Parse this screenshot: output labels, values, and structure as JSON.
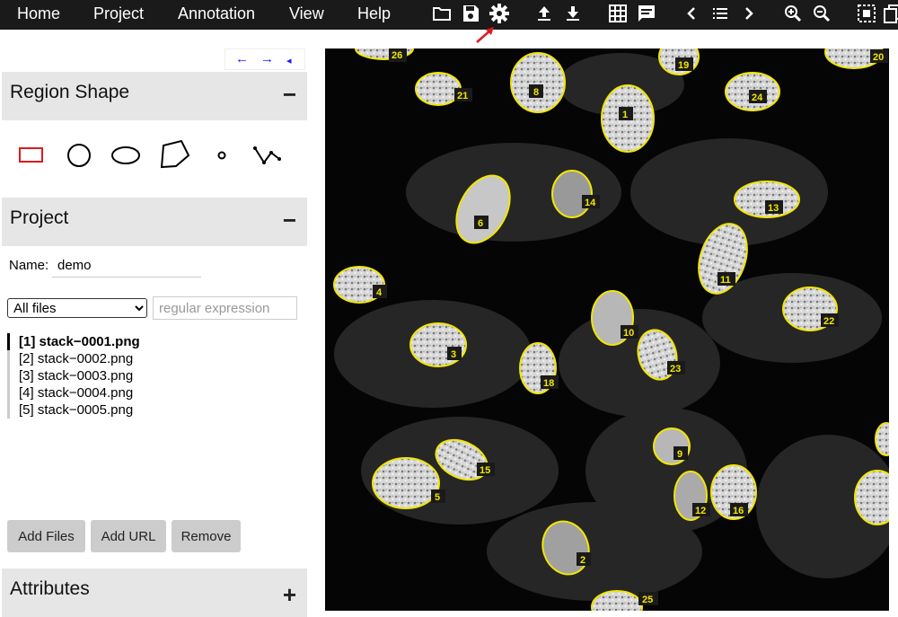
{
  "menu": {
    "items": [
      "Home",
      "Project",
      "Annotation",
      "View",
      "Help"
    ]
  },
  "toolbar": {
    "icons": [
      "folder-open-icon",
      "save-icon",
      "settings-icon",
      "upload-icon",
      "download-icon",
      "grid-view-icon",
      "comment-icon",
      "previous-icon",
      "list-icon",
      "next-icon",
      "zoom-in-icon",
      "zoom-out-icon",
      "select-all-icon",
      "copy-icon"
    ]
  },
  "nav_arrows": {
    "left": "←",
    "right": "→",
    "collapse": "◂"
  },
  "region_shape": {
    "title": "Region Shape",
    "toggle": "−",
    "shapes": [
      "rectangle",
      "circle",
      "ellipse",
      "polygon",
      "point",
      "polyline"
    ],
    "selected": "rectangle"
  },
  "project": {
    "title": "Project",
    "toggle": "−",
    "name_label": "Name:",
    "name_value": "demo",
    "filter_selected": "All files",
    "regex_placeholder": "regular expression",
    "files": [
      "[1] stack−0001.png",
      "[2] stack−0002.png",
      "[3] stack−0003.png",
      "[4] stack−0004.png",
      "[5] stack−0005.png"
    ],
    "active_file_index": 0,
    "buttons": {
      "add_files": "Add Files",
      "add_url": "Add URL",
      "remove": "Remove"
    }
  },
  "attributes": {
    "title": "Attributes",
    "toggle": "+"
  },
  "region_labels": [
    "1",
    "2",
    "3",
    "4",
    "5",
    "6",
    "8",
    "9",
    "10",
    "11",
    "12",
    "13",
    "14",
    "15",
    "16",
    "18",
    "19",
    "20",
    "21",
    "22",
    "23",
    "24",
    "25",
    "26"
  ],
  "colors": {
    "menu_bg": "#1a1a1a",
    "region_outline": "#f2e600",
    "panel_header_bg": "#e6e6e6",
    "nav_arrow": "#1a1aff",
    "selected_shape": "#e0191f",
    "pointer_arrow": "#e0191f"
  }
}
